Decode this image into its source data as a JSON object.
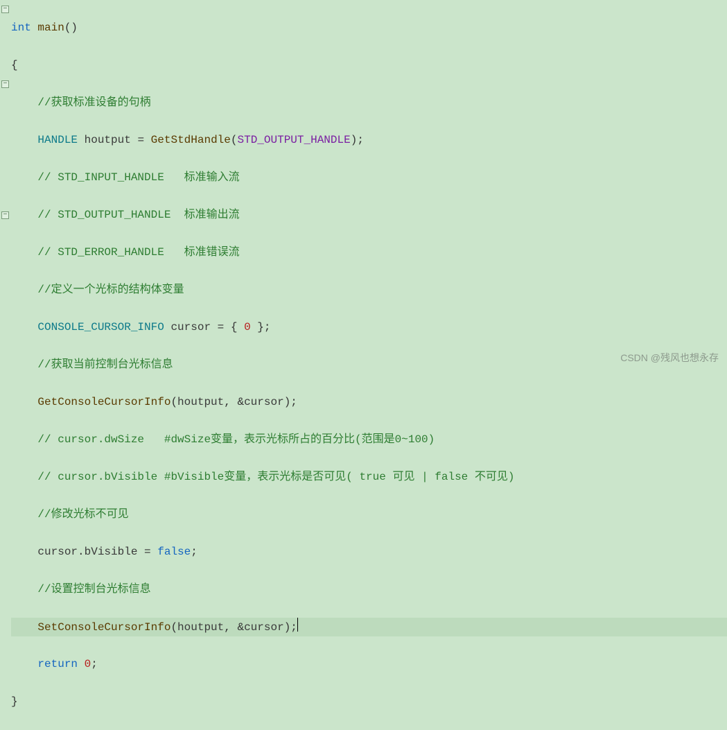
{
  "fold_markers": [
    {
      "line": 0,
      "symbol": "−"
    },
    {
      "line": 4,
      "symbol": "−"
    },
    {
      "line": 11,
      "symbol": "−"
    }
  ],
  "code": {
    "l0": {
      "kw_int": "int",
      "func_main": "main",
      "paren": "()"
    },
    "l1": {
      "brace": "{"
    },
    "l2": {
      "comment": "//获取标准设备的句柄"
    },
    "l3": {
      "type_handle": "HANDLE",
      "ident_houtput": "houtput",
      "eq": " = ",
      "func_get": "GetStdHandle",
      "open": "(",
      "const_std": "STD_OUTPUT_HANDLE",
      "close": ");"
    },
    "l4": {
      "comment": "// STD_INPUT_HANDLE   标准输入流"
    },
    "l5": {
      "comment": "// STD_OUTPUT_HANDLE  标准输出流"
    },
    "l6": {
      "comment": "// STD_ERROR_HANDLE   标准错误流"
    },
    "l7": {
      "comment": "//定义一个光标的结构体变量"
    },
    "l8": {
      "type_cci": "CONSOLE_CURSOR_INFO",
      "ident_cursor": "cursor",
      "eq": " = { ",
      "num_zero": "0",
      "close": " };"
    },
    "l9": {
      "comment": "//获取当前控制台光标信息"
    },
    "l10": {
      "func_get": "GetConsoleCursorInfo",
      "open": "(",
      "arg1": "houtput",
      "comma": ", &",
      "arg2": "cursor",
      "close": ");"
    },
    "l11": {
      "comment": "// cursor.dwSize   #dwSize变量，表示光标所占的百分比(范围是0~100)"
    },
    "l12": {
      "comment": "// cursor.bVisible #bVisible变量，表示光标是否可见( true 可见 | false 不可见)"
    },
    "l13": {
      "comment": "//修改光标不可见"
    },
    "l14": {
      "ident_cursor": "cursor",
      "dot": ".",
      "member": "bVisible",
      "eq": " = ",
      "bool_false": "false",
      "semi": ";"
    },
    "l15": {
      "comment": "//设置控制台光标信息"
    },
    "l16": {
      "func_set": "SetConsoleCursorInfo",
      "open": "(",
      "arg1": "houtput",
      "comma": ", &",
      "arg2": "cursor",
      "close": ");"
    },
    "l17": {
      "kw_return": "return",
      "sp": " ",
      "num_zero": "0",
      "semi": ";"
    },
    "l18": {
      "brace": "}"
    }
  },
  "watermark": "CSDN @残风也想永存"
}
